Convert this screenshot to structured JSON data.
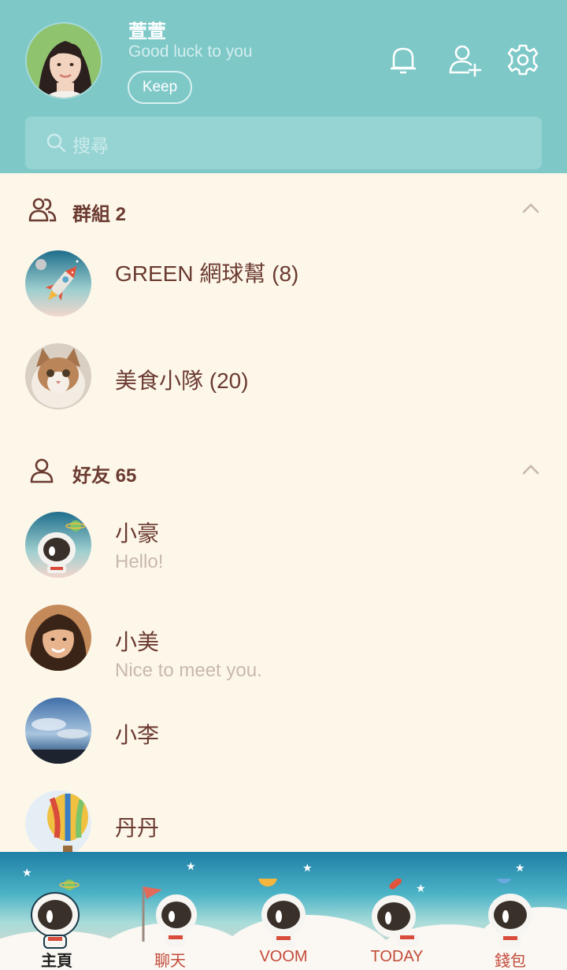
{
  "header": {
    "name": "萱萱",
    "status": "Good luck to you",
    "keep_label": "Keep",
    "search_placeholder": "搜尋"
  },
  "groups": {
    "title": "群組 2",
    "items": [
      {
        "name": "GREEN 網球幫 (8)"
      },
      {
        "name": "美食小隊 (20)"
      }
    ]
  },
  "friends": {
    "title": "好友 65",
    "items": [
      {
        "name": "小豪",
        "message": "Hello!"
      },
      {
        "name": "小美",
        "message": "Nice to meet you."
      },
      {
        "name": "小李",
        "message": ""
      },
      {
        "name": "丹丹",
        "message": ""
      }
    ]
  },
  "tabs": [
    {
      "label": "主頁",
      "active": true
    },
    {
      "label": "聊天",
      "active": false
    },
    {
      "label": "VOOM",
      "active": false
    },
    {
      "label": "TODAY",
      "active": false
    },
    {
      "label": "錢包",
      "active": false
    }
  ],
  "colors": {
    "header_bg": "#7ec8c8",
    "list_bg": "#fdf7ea",
    "text_primary": "#6b3a30",
    "text_secondary": "#c9b8ad",
    "tab_label": "#c24b3a"
  },
  "icons": [
    "bell-icon",
    "add-friend-icon",
    "gear-icon",
    "search-icon",
    "group-icon",
    "person-icon",
    "chevron-up-icon"
  ]
}
